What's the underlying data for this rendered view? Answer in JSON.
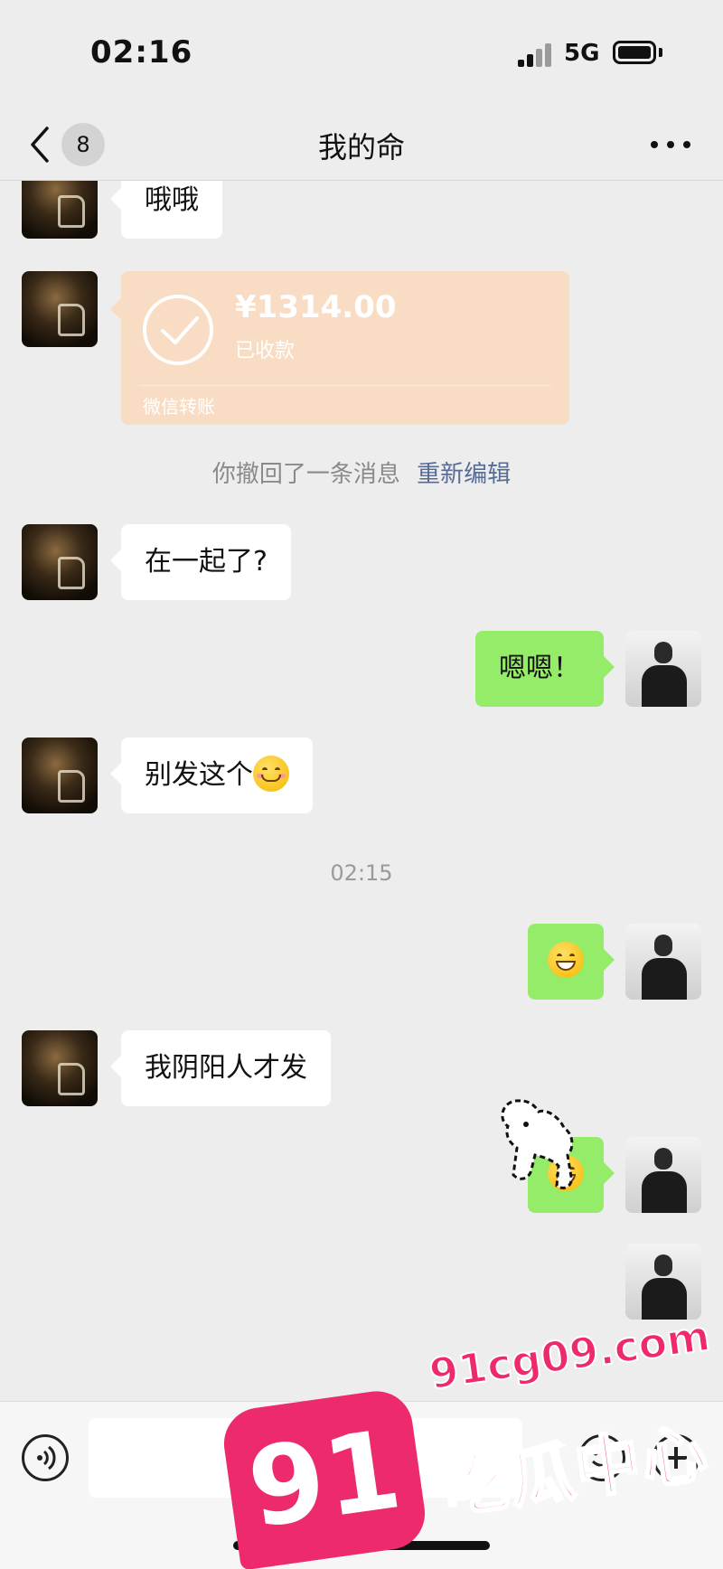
{
  "status_bar": {
    "time": "02:16",
    "network": "5G"
  },
  "nav": {
    "back_count": "8",
    "title": "我的命"
  },
  "messages": {
    "m1": "哦哦",
    "transfer": {
      "amount": "¥1314.00",
      "status": "已收款",
      "footer": "微信转账"
    },
    "recall_notice": "你撤回了一条消息",
    "recall_link": "重新编辑",
    "m3": "在一起了?",
    "m4": "嗯嗯！",
    "m5": "别发这个",
    "timestamp": "02:15",
    "m7": "我阴阳人才发"
  },
  "watermark": {
    "number": "91",
    "domain": "91cg09.com",
    "text": "吃瓜中心"
  },
  "colors": {
    "background": "#ededed",
    "outgoing_bubble": "#95ec69",
    "incoming_bubble": "#ffffff",
    "transfer_card": "#f9dcc4",
    "link": "#576b95",
    "watermark": "#ee2a6e"
  }
}
